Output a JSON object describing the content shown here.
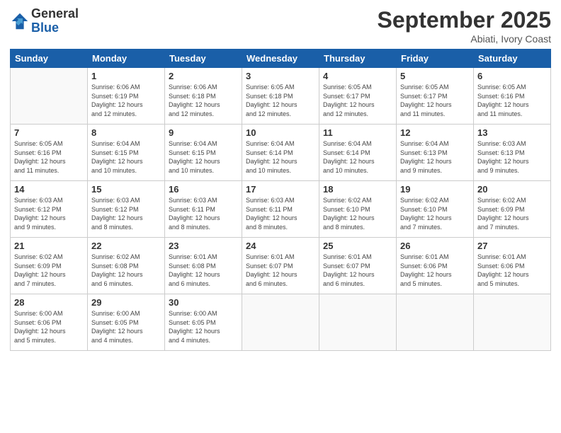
{
  "logo": {
    "general": "General",
    "blue": "Blue"
  },
  "title": "September 2025",
  "location": "Abiati, Ivory Coast",
  "days_of_week": [
    "Sunday",
    "Monday",
    "Tuesday",
    "Wednesday",
    "Thursday",
    "Friday",
    "Saturday"
  ],
  "weeks": [
    [
      {
        "day": "",
        "detail": ""
      },
      {
        "day": "1",
        "detail": "Sunrise: 6:06 AM\nSunset: 6:19 PM\nDaylight: 12 hours\nand 12 minutes."
      },
      {
        "day": "2",
        "detail": "Sunrise: 6:06 AM\nSunset: 6:18 PM\nDaylight: 12 hours\nand 12 minutes."
      },
      {
        "day": "3",
        "detail": "Sunrise: 6:05 AM\nSunset: 6:18 PM\nDaylight: 12 hours\nand 12 minutes."
      },
      {
        "day": "4",
        "detail": "Sunrise: 6:05 AM\nSunset: 6:17 PM\nDaylight: 12 hours\nand 12 minutes."
      },
      {
        "day": "5",
        "detail": "Sunrise: 6:05 AM\nSunset: 6:17 PM\nDaylight: 12 hours\nand 11 minutes."
      },
      {
        "day": "6",
        "detail": "Sunrise: 6:05 AM\nSunset: 6:16 PM\nDaylight: 12 hours\nand 11 minutes."
      }
    ],
    [
      {
        "day": "7",
        "detail": "Sunrise: 6:05 AM\nSunset: 6:16 PM\nDaylight: 12 hours\nand 11 minutes."
      },
      {
        "day": "8",
        "detail": "Sunrise: 6:04 AM\nSunset: 6:15 PM\nDaylight: 12 hours\nand 10 minutes."
      },
      {
        "day": "9",
        "detail": "Sunrise: 6:04 AM\nSunset: 6:15 PM\nDaylight: 12 hours\nand 10 minutes."
      },
      {
        "day": "10",
        "detail": "Sunrise: 6:04 AM\nSunset: 6:14 PM\nDaylight: 12 hours\nand 10 minutes."
      },
      {
        "day": "11",
        "detail": "Sunrise: 6:04 AM\nSunset: 6:14 PM\nDaylight: 12 hours\nand 10 minutes."
      },
      {
        "day": "12",
        "detail": "Sunrise: 6:04 AM\nSunset: 6:13 PM\nDaylight: 12 hours\nand 9 minutes."
      },
      {
        "day": "13",
        "detail": "Sunrise: 6:03 AM\nSunset: 6:13 PM\nDaylight: 12 hours\nand 9 minutes."
      }
    ],
    [
      {
        "day": "14",
        "detail": "Sunrise: 6:03 AM\nSunset: 6:12 PM\nDaylight: 12 hours\nand 9 minutes."
      },
      {
        "day": "15",
        "detail": "Sunrise: 6:03 AM\nSunset: 6:12 PM\nDaylight: 12 hours\nand 8 minutes."
      },
      {
        "day": "16",
        "detail": "Sunrise: 6:03 AM\nSunset: 6:11 PM\nDaylight: 12 hours\nand 8 minutes."
      },
      {
        "day": "17",
        "detail": "Sunrise: 6:03 AM\nSunset: 6:11 PM\nDaylight: 12 hours\nand 8 minutes."
      },
      {
        "day": "18",
        "detail": "Sunrise: 6:02 AM\nSunset: 6:10 PM\nDaylight: 12 hours\nand 8 minutes."
      },
      {
        "day": "19",
        "detail": "Sunrise: 6:02 AM\nSunset: 6:10 PM\nDaylight: 12 hours\nand 7 minutes."
      },
      {
        "day": "20",
        "detail": "Sunrise: 6:02 AM\nSunset: 6:09 PM\nDaylight: 12 hours\nand 7 minutes."
      }
    ],
    [
      {
        "day": "21",
        "detail": "Sunrise: 6:02 AM\nSunset: 6:09 PM\nDaylight: 12 hours\nand 7 minutes."
      },
      {
        "day": "22",
        "detail": "Sunrise: 6:02 AM\nSunset: 6:08 PM\nDaylight: 12 hours\nand 6 minutes."
      },
      {
        "day": "23",
        "detail": "Sunrise: 6:01 AM\nSunset: 6:08 PM\nDaylight: 12 hours\nand 6 minutes."
      },
      {
        "day": "24",
        "detail": "Sunrise: 6:01 AM\nSunset: 6:07 PM\nDaylight: 12 hours\nand 6 minutes."
      },
      {
        "day": "25",
        "detail": "Sunrise: 6:01 AM\nSunset: 6:07 PM\nDaylight: 12 hours\nand 6 minutes."
      },
      {
        "day": "26",
        "detail": "Sunrise: 6:01 AM\nSunset: 6:06 PM\nDaylight: 12 hours\nand 5 minutes."
      },
      {
        "day": "27",
        "detail": "Sunrise: 6:01 AM\nSunset: 6:06 PM\nDaylight: 12 hours\nand 5 minutes."
      }
    ],
    [
      {
        "day": "28",
        "detail": "Sunrise: 6:00 AM\nSunset: 6:06 PM\nDaylight: 12 hours\nand 5 minutes."
      },
      {
        "day": "29",
        "detail": "Sunrise: 6:00 AM\nSunset: 6:05 PM\nDaylight: 12 hours\nand 4 minutes."
      },
      {
        "day": "30",
        "detail": "Sunrise: 6:00 AM\nSunset: 6:05 PM\nDaylight: 12 hours\nand 4 minutes."
      },
      {
        "day": "",
        "detail": ""
      },
      {
        "day": "",
        "detail": ""
      },
      {
        "day": "",
        "detail": ""
      },
      {
        "day": "",
        "detail": ""
      }
    ]
  ]
}
